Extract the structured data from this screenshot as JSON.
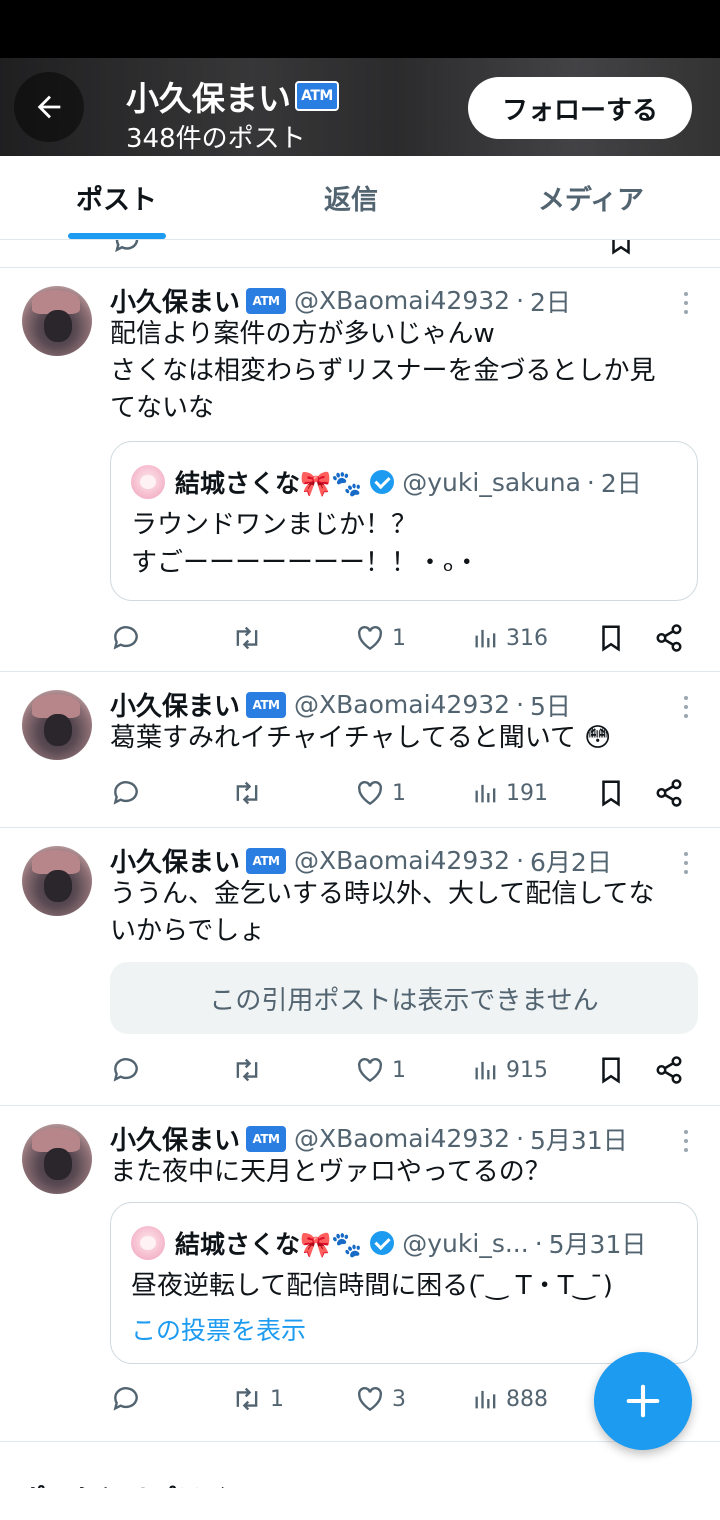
{
  "header": {
    "display_name": "小久保まい",
    "name_badge": "ATM",
    "post_count": "348件のポスト",
    "follow_label": "フォローする"
  },
  "tabs": [
    {
      "label": "ポスト",
      "active": true
    },
    {
      "label": "返信",
      "active": false
    },
    {
      "label": "メディア",
      "active": false
    }
  ],
  "posts": [
    {
      "name": "小久保まい",
      "badge": "ATM",
      "handle": "@XBaomai42932",
      "time": "2日",
      "lines": [
        "配信より案件の方が多いじゃんw",
        "さくなは相変わらずリスナーを金づるとしか見",
        "てないな"
      ],
      "quote": {
        "name": "結城さくな🎀🐾",
        "handle": "@yuki_sakuna",
        "time": "2日",
        "lines": [
          "ラウンドワンまじか！？",
          "すごーーーーーーー！！・ₒ・"
        ]
      },
      "actions": {
        "reply": "",
        "repost": "",
        "like": "1",
        "views": "316"
      }
    },
    {
      "name": "小久保まい",
      "badge": "ATM",
      "handle": "@XBaomai42932",
      "time": "5日",
      "lines": [
        "葛葉すみれイチャイチャしてると聞いて 😳"
      ],
      "actions": {
        "reply": "",
        "repost": "",
        "like": "1",
        "views": "191"
      }
    },
    {
      "name": "小久保まい",
      "badge": "ATM",
      "handle": "@XBaomai42932",
      "time": "6月2日",
      "lines": [
        "ううん、金乞いする時以外、大して配信してな",
        "いからでしょ"
      ],
      "unavailable": "この引用ポストは表示できません",
      "actions": {
        "reply": "",
        "repost": "",
        "like": "1",
        "views": "915"
      }
    },
    {
      "name": "小久保まい",
      "badge": "ATM",
      "handle": "@XBaomai42932",
      "time": "5月31日",
      "lines": [
        "また夜中に天月とヴァロやってるの？"
      ],
      "quote": {
        "name": "結城さくな🎀🐾",
        "handle": "@yuki_s...",
        "time": "5月31日",
        "lines": [
          "昼夜逆転して配信時間に困る( ̄‿ T・T‿ ̄)"
        ],
        "link": "この投票を表示"
      },
      "actions": {
        "reply": "",
        "repost": "1",
        "like": "3",
        "views": "888"
      }
    }
  ],
  "icons": {
    "back": "arrow-left-icon",
    "reply": "reply-icon",
    "repost": "repost-icon",
    "like": "heart-icon",
    "views": "views-icon",
    "bookmark": "bookmark-icon",
    "share": "share-icon",
    "compose": "plus-icon"
  },
  "colors": {
    "accent": "#1d9bf0",
    "muted": "#536471",
    "text": "#0f1419",
    "badge": "#2a7de1"
  },
  "bottom_partial_text": "ポストとリプライ"
}
